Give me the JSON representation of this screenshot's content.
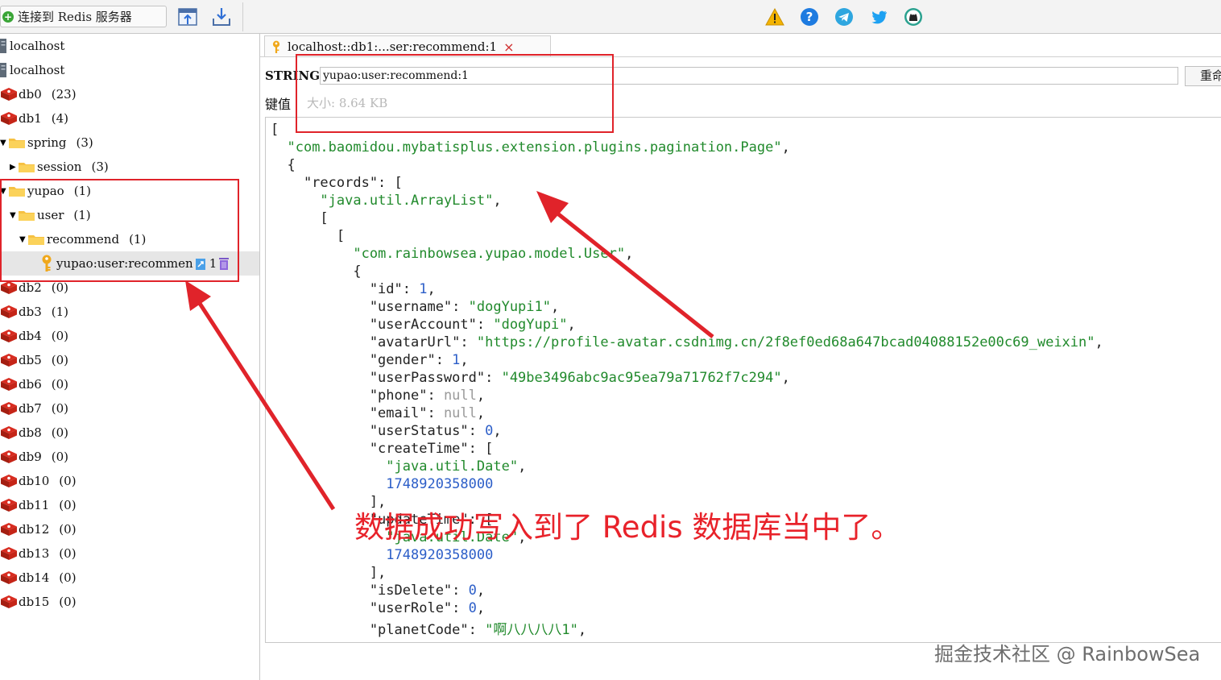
{
  "toolbar": {
    "connect_label": "连接到 Redis 服务器",
    "right_icons": [
      "warning-icon",
      "help-icon",
      "telegram-icon",
      "twitter-icon",
      "github-icon"
    ]
  },
  "sidebar": {
    "items": [
      {
        "kind": "server",
        "label": "localhost"
      },
      {
        "kind": "server",
        "label": "localhost"
      },
      {
        "kind": "db",
        "label": "db0",
        "count": "(23)"
      },
      {
        "kind": "db",
        "label": "db1",
        "count": "(4)"
      },
      {
        "kind": "folder",
        "label": "spring",
        "count": "(3)"
      },
      {
        "kind": "folder",
        "label": "session",
        "count": "(3)"
      },
      {
        "kind": "folder",
        "label": "yupao",
        "count": "(1)"
      },
      {
        "kind": "folder",
        "label": "user",
        "count": "(1)"
      },
      {
        "kind": "folder",
        "label": "recommend",
        "count": "(1)"
      },
      {
        "kind": "key",
        "label": "yupao:user:recommen",
        "badge": "1"
      },
      {
        "kind": "db",
        "label": "db2",
        "count": "(0)"
      },
      {
        "kind": "db",
        "label": "db3",
        "count": "(1)"
      },
      {
        "kind": "db",
        "label": "db4",
        "count": "(0)"
      },
      {
        "kind": "db",
        "label": "db5",
        "count": "(0)"
      },
      {
        "kind": "db",
        "label": "db6",
        "count": "(0)"
      },
      {
        "kind": "db",
        "label": "db7",
        "count": "(0)"
      },
      {
        "kind": "db",
        "label": "db8",
        "count": "(0)"
      },
      {
        "kind": "db",
        "label": "db9",
        "count": "(0)"
      },
      {
        "kind": "db",
        "label": "db10",
        "count": "(0)"
      },
      {
        "kind": "db",
        "label": "db11",
        "count": "(0)"
      },
      {
        "kind": "db",
        "label": "db12",
        "count": "(0)"
      },
      {
        "kind": "db",
        "label": "db13",
        "count": "(0)"
      },
      {
        "kind": "db",
        "label": "db14",
        "count": "(0)"
      },
      {
        "kind": "db",
        "label": "db15",
        "count": "(0)"
      }
    ]
  },
  "tab": {
    "label": "localhost::db1:...ser:recommend:1",
    "close": "×"
  },
  "key_panel": {
    "type_label": "STRING:",
    "key_value": "yupao:user:recommend:1",
    "rename_label": "重命",
    "ttl_label": "键值",
    "size_text": "大小: 8.64 KB"
  },
  "value_lines": [
    "[",
    "  \"com.baomidou.mybatisplus.extension.plugins.pagination.Page\",",
    "  {",
    "    \"records\": [",
    "      \"java.util.ArrayList\",",
    "      [",
    "        [",
    "          \"com.rainbowsea.yupao.model.User\",",
    "          {",
    "            \"id\": 1,",
    "            \"username\": \"dogYupi1\",",
    "            \"userAccount\": \"dogYupi\",",
    "            \"avatarUrl\": \"https://profile-avatar.csdnimg.cn/2f8ef0ed68a647bcad04088152e00c69_weixin\",",
    "            \"gender\": 1,",
    "            \"userPassword\": \"49be3496abc9ac95ea79a71762f7c294\",",
    "            \"phone\": null,",
    "            \"email\": null,",
    "            \"userStatus\": 0,",
    "            \"createTime\": [",
    "              \"java.util.Date\",",
    "              1748920358000",
    "            ],",
    "            \"updateTime\": [",
    "              \"java.util.Date\",",
    "              1748920358000",
    "            ],",
    "            \"isDelete\": 0,",
    "            \"userRole\": 0,",
    "            \"planetCode\": \"啊八八八八1\","
  ],
  "annotation": {
    "text": "数据成功写入到了 Redis 数据库当中了。"
  },
  "watermark": "掘金技术社区 @ RainbowSea",
  "colors": {
    "annotation_red": "#e0232a",
    "string_green": "#218a2c",
    "number_blue": "#2c5ec8"
  }
}
